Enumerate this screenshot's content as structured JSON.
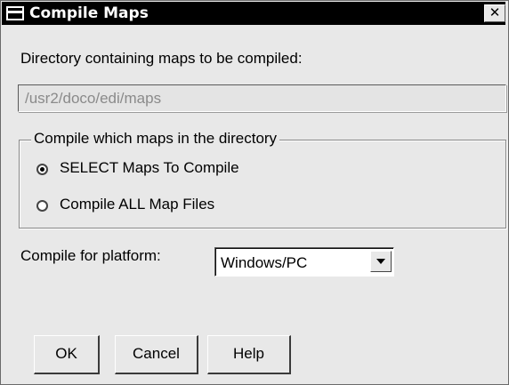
{
  "window": {
    "title": "Compile Maps",
    "close_glyph": "✕",
    "icons": [
      "system-menu-icon",
      "close-icon"
    ]
  },
  "directory": {
    "label": "Directory containing maps to be compiled:",
    "value": "/usr2/doco/edi/maps"
  },
  "compile_group": {
    "legend": "Compile which maps in the directory",
    "options": [
      {
        "label": "SELECT Maps To Compile",
        "selected": true
      },
      {
        "label": "Compile ALL Map Files",
        "selected": false
      }
    ]
  },
  "platform": {
    "label": "Compile for platform:",
    "value": "Windows/PC"
  },
  "buttons": {
    "ok": "OK",
    "cancel": "Cancel",
    "help": "Help"
  }
}
